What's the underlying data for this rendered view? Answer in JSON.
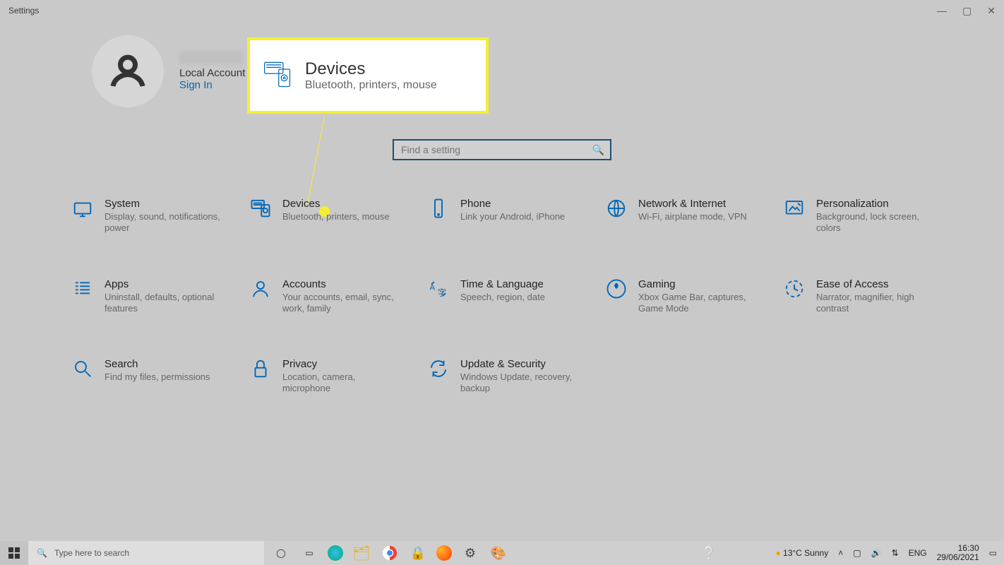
{
  "window": {
    "title": "Settings"
  },
  "user": {
    "account_type": "Local Account",
    "signin": "Sign In"
  },
  "search": {
    "placeholder": "Find a setting"
  },
  "callout": {
    "title": "Devices",
    "desc": "Bluetooth, printers, mouse"
  },
  "tiles": [
    {
      "id": "system",
      "title": "System",
      "desc": "Display, sound, notifications, power"
    },
    {
      "id": "devices",
      "title": "Devices",
      "desc": "Bluetooth, printers, mouse"
    },
    {
      "id": "phone",
      "title": "Phone",
      "desc": "Link your Android, iPhone"
    },
    {
      "id": "network",
      "title": "Network & Internet",
      "desc": "Wi-Fi, airplane mode, VPN"
    },
    {
      "id": "personalization",
      "title": "Personalization",
      "desc": "Background, lock screen, colors"
    },
    {
      "id": "apps",
      "title": "Apps",
      "desc": "Uninstall, defaults, optional features"
    },
    {
      "id": "accounts",
      "title": "Accounts",
      "desc": "Your accounts, email, sync, work, family"
    },
    {
      "id": "time",
      "title": "Time & Language",
      "desc": "Speech, region, date"
    },
    {
      "id": "gaming",
      "title": "Gaming",
      "desc": "Xbox Game Bar, captures, Game Mode"
    },
    {
      "id": "ease",
      "title": "Ease of Access",
      "desc": "Narrator, magnifier, high contrast"
    },
    {
      "id": "searchcat",
      "title": "Search",
      "desc": "Find my files, permissions"
    },
    {
      "id": "privacy",
      "title": "Privacy",
      "desc": "Location, camera, microphone"
    },
    {
      "id": "update",
      "title": "Update & Security",
      "desc": "Windows Update, recovery, backup"
    }
  ],
  "taskbar": {
    "search_placeholder": "Type here to search",
    "weather": "13°C  Sunny",
    "lang": "ENG",
    "time": "16:30",
    "date": "29/06/2021"
  }
}
